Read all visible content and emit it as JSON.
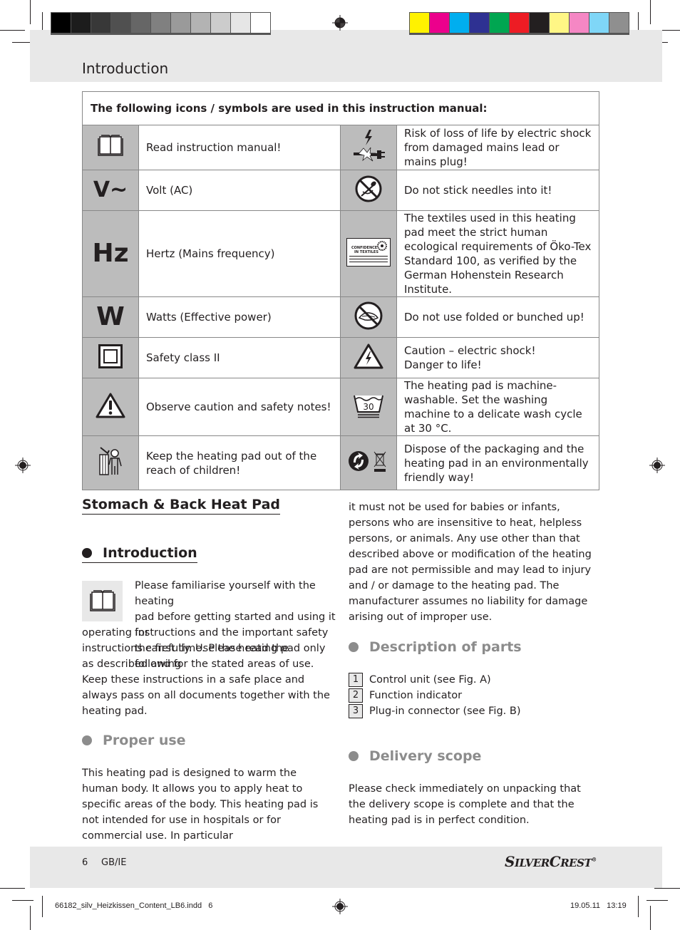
{
  "header": {
    "title": "Introduction",
    "gray_swatches": [
      "#000000",
      "#1c1c1c",
      "#383838",
      "#505050",
      "#666666",
      "#808080",
      "#9a9a9a",
      "#b3b3b3",
      "#cccccc",
      "#e6e6e6",
      "#ffffff"
    ],
    "color_swatches": [
      "#fff200",
      "#ec008c",
      "#00aeef",
      "#2e3192",
      "#00a651",
      "#ed1c24",
      "#231f20",
      "#fff685",
      "#f587c4",
      "#7fd6f7",
      "#8f8f8f"
    ]
  },
  "symbols_table": {
    "heading": "The following icons / symbols are used in this instruction manual:",
    "rows": [
      {
        "left_icon": "book-icon",
        "left_text": "Read instruction manual!",
        "right_icon": "damaged-cable-shock-icon",
        "right_text": "Risk of loss of life by electric shock from damaged mains lead or mains plug!"
      },
      {
        "left_icon": "volt-ac-symbol",
        "left_symbol": "V~",
        "left_text": "Volt (AC)",
        "right_icon": "no-needles-icon",
        "right_text": "Do not stick needles into it!"
      },
      {
        "left_icon": "hertz-symbol",
        "left_symbol": "Hz",
        "left_text": "Hertz (Mains frequency)",
        "right_icon": "oeko-tex-label-icon",
        "right_label_lines": [
          "CONFIDENCE",
          "IN TEXTILES"
        ],
        "right_text": "The textiles used in this heating pad meet the strict human ecological requirements of Öko-Tex Standard 100, as verified by the German Hohenstein Research Institute."
      },
      {
        "left_icon": "watts-symbol",
        "left_symbol": "W",
        "left_text": "Watts (Effective power)",
        "right_icon": "no-folding-icon",
        "right_text": "Do not use folded or bunched up!"
      },
      {
        "left_icon": "safety-class-ii-icon",
        "left_text": "Safety class II",
        "right_icon": "electric-shock-warning-icon",
        "right_text_lines": [
          "Caution – electric shock!",
          "Danger to life!"
        ]
      },
      {
        "left_icon": "caution-warning-icon",
        "left_text": "Observe caution and safety notes!",
        "right_icon": "wash-30-icon",
        "right_wash_temp": "30",
        "right_text": "The heating pad is machine-washable. Set the washing machine to a delicate wash cycle at 30 °C."
      },
      {
        "left_icon": "keep-away-children-icon",
        "left_text": "Keep the heating pad out of the reach of children!",
        "right_icon": "recycling-disposal-icon",
        "right_text": "Dispose of the packaging and the heating pad in an environmentally friendly way!"
      }
    ]
  },
  "product_title": "Stomach & Back Heat Pad",
  "sections": {
    "introduction": {
      "heading": "Introduction",
      "text_lines_wrapped": [
        "Please familiarise yourself with the heating",
        "pad before getting started and using it for",
        "the first time. Please read the following"
      ],
      "text_rest": "operating instructions and the important safety instructions carefully. Use the heating pad only as described and for the stated areas of use. Keep these instructions in a safe place and always pass on all documents together with the heating pad."
    },
    "proper_use": {
      "heading": "Proper use",
      "text": "This heating pad is designed to warm the human body. It allows you to apply heat to specific areas of the body. This heating pad is not intended for use in hospitals or for commercial use. In particular",
      "text_continued": "it must not be used for babies or infants, persons who are insensitive to heat, helpless persons, or animals. Any use other than that described above or modification of the heating pad are not permissible and may lead to injury and / or damage to the heating pad. The manufacturer assumes no liability for damage arising out of improper use."
    },
    "description_of_parts": {
      "heading": "Description of parts",
      "parts": [
        {
          "number": "1",
          "label": "Control unit (see Fig. A)"
        },
        {
          "number": "2",
          "label": "Function indicator"
        },
        {
          "number": "3",
          "label": "Plug-in connector (see Fig. B)"
        }
      ]
    },
    "delivery_scope": {
      "heading": "Delivery scope",
      "text": "Please check immediately on unpacking that the delivery scope is complete and that the heating pad is in perfect condition."
    }
  },
  "footer": {
    "page_number": "6",
    "locale": "GB/IE",
    "brand_first": "S",
    "brand_first_small": "ILVER",
    "brand_second": "C",
    "brand_second_small": "REST",
    "brand_mark": "®",
    "slug_file": "66182_silv_Heizkissen_Content_LB6.indd   6",
    "slug_datetime": "19.05.11   13:19"
  }
}
